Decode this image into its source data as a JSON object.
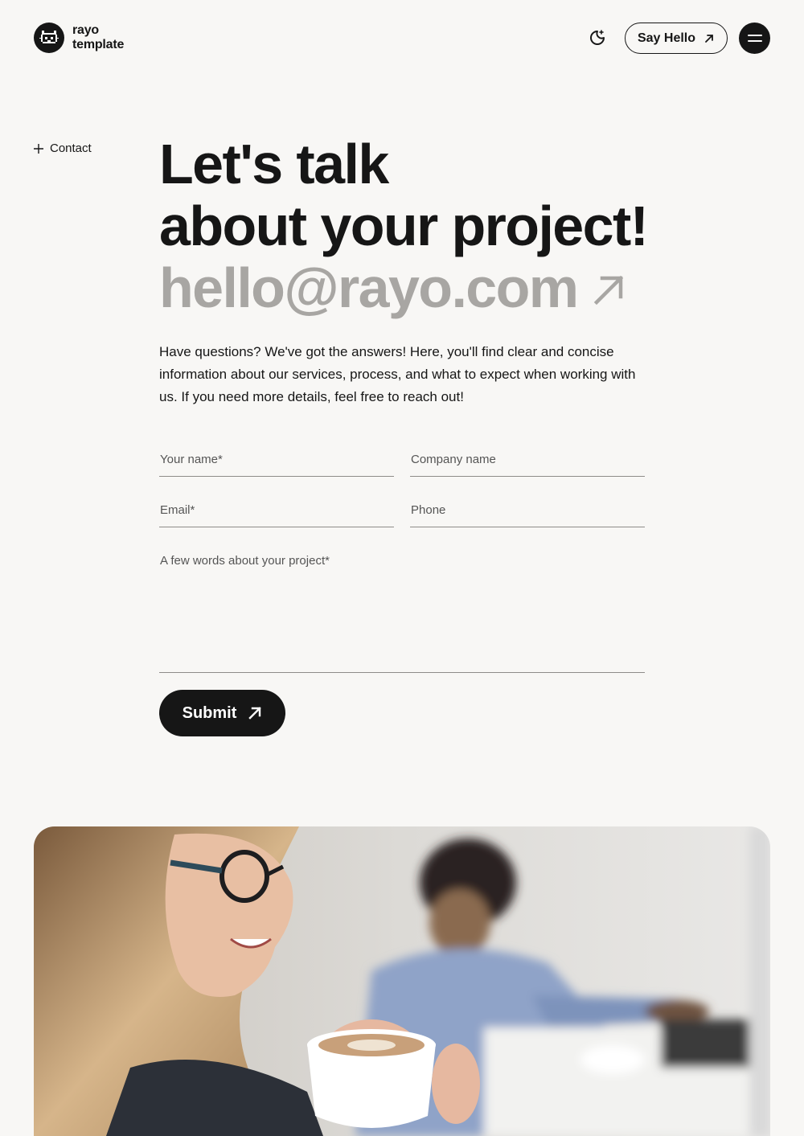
{
  "header": {
    "logo_line1": "rayo",
    "logo_line2": "template",
    "theme_icon": "moon-icon",
    "say_hello_label": "Say Hello",
    "menu_icon": "hamburger-icon"
  },
  "section": {
    "label": "Contact"
  },
  "hero": {
    "title_line1": "Let's talk",
    "title_line2": "about your project!",
    "email": "hello@rayo.com",
    "intro": "Have questions? We've got the answers! Here, you'll find clear and concise information about our services, process, and what to expect when working with us. If you need more details, feel free to reach out!"
  },
  "form": {
    "name_placeholder": "Your name*",
    "company_placeholder": "Company name",
    "email_placeholder": "Email*",
    "phone_placeholder": "Phone",
    "message_placeholder": "A few words about your project*",
    "submit_label": "Submit"
  },
  "colors": {
    "background": "#f8f7f5",
    "ink": "#161616",
    "muted": "#a8a6a3"
  }
}
